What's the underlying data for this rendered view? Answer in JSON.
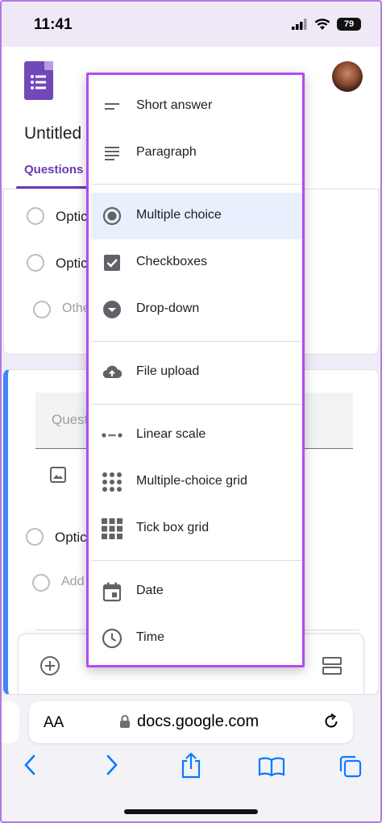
{
  "status_bar": {
    "time": "11:41",
    "battery": "79"
  },
  "header": {
    "form_title": "Untitled",
    "tab_label": "Questions"
  },
  "card1": {
    "options": [
      "Optic",
      "Optic"
    ],
    "other_label": "Othe"
  },
  "card2": {
    "question_placeholder": "Quest",
    "option": "Optic",
    "add_option": "Add"
  },
  "menu": {
    "items": [
      {
        "label": "Short answer",
        "icon": "short-answer-icon"
      },
      {
        "label": "Paragraph",
        "icon": "paragraph-icon"
      },
      {
        "label": "Multiple choice",
        "icon": "radio-icon",
        "selected": true
      },
      {
        "label": "Checkboxes",
        "icon": "checkbox-icon"
      },
      {
        "label": "Drop-down",
        "icon": "dropdown-icon"
      },
      {
        "label": "File upload",
        "icon": "cloud-upload-icon"
      },
      {
        "label": "Linear scale",
        "icon": "linear-scale-icon"
      },
      {
        "label": "Multiple-choice grid",
        "icon": "grid-dots-icon"
      },
      {
        "label": "Tick box grid",
        "icon": "grid-squares-icon"
      },
      {
        "label": "Date",
        "icon": "calendar-icon"
      },
      {
        "label": "Time",
        "icon": "clock-icon"
      }
    ]
  },
  "safari": {
    "aa_label": "AA",
    "url": "docs.google.com"
  },
  "colors": {
    "accent": "#673ab7",
    "menu_border": "#b24bf3",
    "selected_bg": "#e8f0fe"
  }
}
